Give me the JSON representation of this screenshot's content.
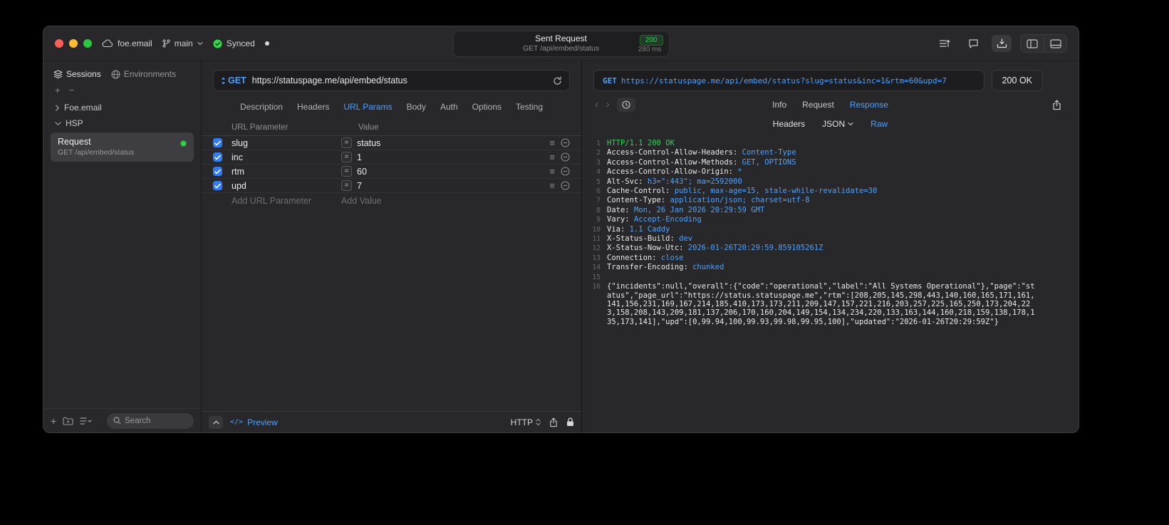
{
  "colors": {
    "accent": "#4ca1ff",
    "success_green": "#30d158",
    "checkbox_blue": "#2f7cf6",
    "window_bg": "#28282a"
  },
  "icons": {
    "plus": "+",
    "minus": "−",
    "menu": "≡",
    "equals": "=",
    "back": "‹",
    "forward": "›",
    "code": "</>"
  },
  "titlebar": {
    "project": "foe.email",
    "branch": "main",
    "sync_label": "Synced",
    "request_title": "Sent Request",
    "request_status": "200",
    "request_subtitle": "GET /api/embed/status",
    "request_duration": "280 ms"
  },
  "sidebar": {
    "tabs": [
      {
        "label": "Sessions"
      },
      {
        "label": "Environments"
      }
    ],
    "groups": [
      {
        "label": "Foe.email"
      },
      {
        "label": "HSP"
      }
    ],
    "request_item": {
      "title": "Request",
      "subtitle": "GET /api/embed/status"
    },
    "search_placeholder": "Search"
  },
  "request_panel": {
    "method": "GET",
    "url": "https://statuspage.me/api/embed/status",
    "tabs": [
      "Description",
      "Headers",
      "URL Params",
      "Body",
      "Auth",
      "Options",
      "Testing"
    ],
    "active_tab": "URL Params",
    "table": {
      "headers": [
        "URL Parameter",
        "Value"
      ],
      "rows": [
        {
          "name": "slug",
          "value": "status",
          "checked": true
        },
        {
          "name": "inc",
          "value": "1",
          "checked": true
        },
        {
          "name": "rtm",
          "value": "60",
          "checked": true
        },
        {
          "name": "upd",
          "value": "7",
          "checked": true
        }
      ],
      "add_name_placeholder": "Add URL Parameter",
      "add_value_placeholder": "Add Value"
    },
    "footer": {
      "preview_label": "Preview",
      "protocol": "HTTP"
    }
  },
  "response_panel": {
    "method": "GET",
    "url": "https://statuspage.me/api/embed/status?slug=status&inc=1&rtm=60&upd=7",
    "status": "200 OK",
    "tabs": [
      "Info",
      "Request",
      "Response"
    ],
    "active_tab": "Response",
    "subtabs": [
      "Headers",
      "JSON",
      "Raw"
    ],
    "active_subtab": "Raw",
    "lines": [
      {
        "n": "1",
        "type": "status",
        "text": "HTTP/1.1 200 OK"
      },
      {
        "n": "2",
        "type": "header",
        "name": "Access-Control-Allow-Headers",
        "value": "Content-Type"
      },
      {
        "n": "3",
        "type": "header",
        "name": "Access-Control-Allow-Methods",
        "value": "GET, OPTIONS"
      },
      {
        "n": "4",
        "type": "header",
        "name": "Access-Control-Allow-Origin",
        "value": "*"
      },
      {
        "n": "5",
        "type": "header",
        "name": "Alt-Svc",
        "value": "h3=\":443\"; ma=2592000"
      },
      {
        "n": "6",
        "type": "header",
        "name": "Cache-Control",
        "value": "public, max-age=15, stale-while-revalidate=30"
      },
      {
        "n": "7",
        "type": "header",
        "name": "Content-Type",
        "value": "application/json; charset=utf-8"
      },
      {
        "n": "8",
        "type": "header",
        "name": "Date",
        "value": "Mon, 26 Jan 2026 20:29:59 GMT"
      },
      {
        "n": "9",
        "type": "header",
        "name": "Vary",
        "value": "Accept-Encoding"
      },
      {
        "n": "10",
        "type": "header",
        "name": "Via",
        "value": "1.1 Caddy"
      },
      {
        "n": "11",
        "type": "header",
        "name": "X-Status-Build",
        "value": "dev"
      },
      {
        "n": "12",
        "type": "header",
        "name": "X-Status-Now-Utc",
        "value": "2026-01-26T20:29:59.859105261Z"
      },
      {
        "n": "13",
        "type": "header",
        "name": "Connection",
        "value": "close"
      },
      {
        "n": "14",
        "type": "header",
        "name": "Transfer-Encoding",
        "value": "chunked"
      },
      {
        "n": "15",
        "type": "blank",
        "text": ""
      },
      {
        "n": "16",
        "type": "body",
        "text": "{\"incidents\":null,\"overall\":{\"code\":\"operational\",\"label\":\"All Systems Operational\"},\"page\":\"status\",\"page_url\":\"https://status.statuspage.me\",\"rtm\":[208,205,145,298,443,140,160,165,171,161,141,156,231,169,167,214,185,410,173,173,211,209,147,157,221,216,203,257,225,165,250,173,204,223,158,208,143,209,181,137,206,170,160,204,149,154,134,234,220,133,163,144,160,218,159,138,178,135,173,141],\"upd\":[0,99.94,100,99.93,99.98,99.95,100],\"updated\":\"2026-01-26T20:29:59Z\"}"
      }
    ]
  }
}
